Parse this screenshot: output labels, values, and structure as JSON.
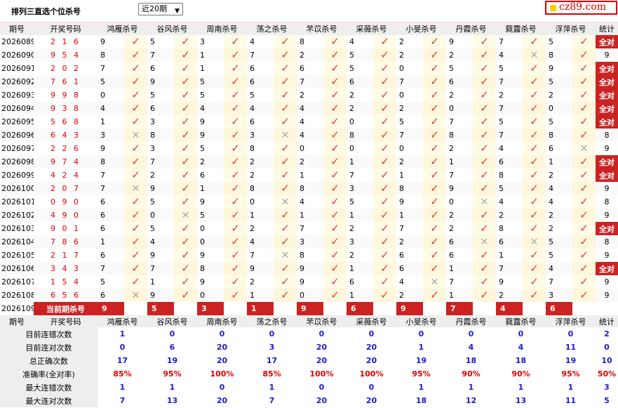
{
  "header": {
    "title": "排列三直选个位杀号",
    "period_select": "近20期",
    "site": "cz89.com"
  },
  "columns": {
    "issue": "期号",
    "draw": "开奖号码",
    "predictors": [
      "鸿雁杀号",
      "谷风杀号",
      "周南杀号",
      "荡之杀号",
      "芣苡杀号",
      "采薇杀号",
      "小旻杀号",
      "丹霞杀号",
      "蕤露杀号",
      "浮萍杀号"
    ],
    "stat": "统计"
  },
  "rows": [
    {
      "issue": "2026089",
      "draw": "2 1 6",
      "picks": [
        [
          9,
          1
        ],
        [
          5,
          1
        ],
        [
          3,
          1
        ],
        [
          4,
          1
        ],
        [
          8,
          1
        ],
        [
          4,
          1
        ],
        [
          2,
          1
        ],
        [
          9,
          1
        ],
        [
          7,
          1
        ],
        [
          5,
          1
        ]
      ],
      "stat": "全对"
    },
    {
      "issue": "2026090",
      "draw": "9 5 4",
      "picks": [
        [
          8,
          1
        ],
        [
          7,
          1
        ],
        [
          1,
          1
        ],
        [
          7,
          1
        ],
        [
          2,
          1
        ],
        [
          5,
          1
        ],
        [
          2,
          1
        ],
        [
          2,
          1
        ],
        [
          4,
          0
        ],
        [
          8,
          1
        ]
      ],
      "stat": "9"
    },
    {
      "issue": "2026091",
      "draw": "2 0 2",
      "picks": [
        [
          7,
          1
        ],
        [
          6,
          1
        ],
        [
          1,
          1
        ],
        [
          6,
          1
        ],
        [
          6,
          1
        ],
        [
          5,
          1
        ],
        [
          0,
          1
        ],
        [
          5,
          1
        ],
        [
          5,
          1
        ],
        [
          9,
          1
        ]
      ],
      "stat": "全对"
    },
    {
      "issue": "2026092",
      "draw": "7 6 1",
      "picks": [
        [
          5,
          1
        ],
        [
          9,
          1
        ],
        [
          5,
          1
        ],
        [
          6,
          1
        ],
        [
          7,
          1
        ],
        [
          6,
          1
        ],
        [
          7,
          1
        ],
        [
          6,
          1
        ],
        [
          7,
          1
        ],
        [
          5,
          1
        ]
      ],
      "stat": "全对"
    },
    {
      "issue": "2026093",
      "draw": "9 9 8",
      "picks": [
        [
          0,
          1
        ],
        [
          5,
          1
        ],
        [
          5,
          1
        ],
        [
          5,
          1
        ],
        [
          2,
          1
        ],
        [
          2,
          1
        ],
        [
          0,
          1
        ],
        [
          2,
          1
        ],
        [
          2,
          1
        ],
        [
          2,
          1
        ]
      ],
      "stat": "全对"
    },
    {
      "issue": "2026094",
      "draw": "9 3 8",
      "picks": [
        [
          4,
          1
        ],
        [
          6,
          1
        ],
        [
          4,
          1
        ],
        [
          4,
          1
        ],
        [
          4,
          1
        ],
        [
          2,
          1
        ],
        [
          2,
          1
        ],
        [
          0,
          1
        ],
        [
          7,
          1
        ],
        [
          0,
          1
        ]
      ],
      "stat": "全对"
    },
    {
      "issue": "2026095",
      "draw": "5 6 8",
      "picks": [
        [
          1,
          1
        ],
        [
          3,
          1
        ],
        [
          9,
          1
        ],
        [
          6,
          1
        ],
        [
          4,
          1
        ],
        [
          0,
          1
        ],
        [
          5,
          1
        ],
        [
          7,
          1
        ],
        [
          5,
          1
        ],
        [
          5,
          1
        ]
      ],
      "stat": "全对"
    },
    {
      "issue": "2026096",
      "draw": "6 4 3",
      "picks": [
        [
          3,
          0
        ],
        [
          8,
          1
        ],
        [
          9,
          1
        ],
        [
          3,
          0
        ],
        [
          4,
          1
        ],
        [
          8,
          1
        ],
        [
          7,
          1
        ],
        [
          8,
          1
        ],
        [
          7,
          1
        ],
        [
          8,
          1
        ]
      ],
      "stat": "8"
    },
    {
      "issue": "2026097",
      "draw": "2 2 6",
      "picks": [
        [
          9,
          1
        ],
        [
          3,
          1
        ],
        [
          5,
          1
        ],
        [
          8,
          1
        ],
        [
          0,
          1
        ],
        [
          0,
          1
        ],
        [
          0,
          1
        ],
        [
          2,
          1
        ],
        [
          4,
          1
        ],
        [
          6,
          0
        ]
      ],
      "stat": "9"
    },
    {
      "issue": "2026098",
      "draw": "9 7 4",
      "picks": [
        [
          8,
          1
        ],
        [
          7,
          1
        ],
        [
          2,
          1
        ],
        [
          2,
          1
        ],
        [
          2,
          1
        ],
        [
          1,
          1
        ],
        [
          2,
          1
        ],
        [
          1,
          1
        ],
        [
          6,
          1
        ],
        [
          1,
          1
        ]
      ],
      "stat": "全对"
    },
    {
      "issue": "2026099",
      "draw": "4 2 4",
      "picks": [
        [
          7,
          1
        ],
        [
          2,
          1
        ],
        [
          6,
          1
        ],
        [
          2,
          1
        ],
        [
          1,
          1
        ],
        [
          7,
          1
        ],
        [
          1,
          1
        ],
        [
          7,
          1
        ],
        [
          8,
          1
        ],
        [
          2,
          1
        ]
      ],
      "stat": "全对"
    },
    {
      "issue": "2026100",
      "draw": "2 0 7",
      "picks": [
        [
          7,
          0
        ],
        [
          9,
          1
        ],
        [
          1,
          1
        ],
        [
          8,
          1
        ],
        [
          8,
          1
        ],
        [
          3,
          1
        ],
        [
          8,
          1
        ],
        [
          9,
          1
        ],
        [
          5,
          1
        ],
        [
          4,
          1
        ]
      ],
      "stat": "9"
    },
    {
      "issue": "2026101",
      "draw": "0 9 0",
      "picks": [
        [
          6,
          1
        ],
        [
          5,
          1
        ],
        [
          9,
          1
        ],
        [
          0,
          0
        ],
        [
          4,
          1
        ],
        [
          5,
          1
        ],
        [
          9,
          1
        ],
        [
          0,
          0
        ],
        [
          4,
          1
        ],
        [
          4,
          1
        ]
      ],
      "stat": "8"
    },
    {
      "issue": "2026102",
      "draw": "4 9 0",
      "picks": [
        [
          6,
          1
        ],
        [
          0,
          0
        ],
        [
          5,
          1
        ],
        [
          1,
          1
        ],
        [
          1,
          1
        ],
        [
          1,
          1
        ],
        [
          1,
          1
        ],
        [
          2,
          1
        ],
        [
          2,
          1
        ],
        [
          2,
          1
        ]
      ],
      "stat": "9"
    },
    {
      "issue": "2026103",
      "draw": "9 0 1",
      "picks": [
        [
          6,
          1
        ],
        [
          5,
          1
        ],
        [
          0,
          1
        ],
        [
          2,
          1
        ],
        [
          7,
          1
        ],
        [
          2,
          1
        ],
        [
          7,
          1
        ],
        [
          2,
          1
        ],
        [
          8,
          1
        ],
        [
          2,
          1
        ]
      ],
      "stat": "全对"
    },
    {
      "issue": "2026104",
      "draw": "7 8 6",
      "picks": [
        [
          1,
          1
        ],
        [
          4,
          1
        ],
        [
          0,
          1
        ],
        [
          4,
          1
        ],
        [
          3,
          1
        ],
        [
          3,
          1
        ],
        [
          2,
          1
        ],
        [
          6,
          0
        ],
        [
          6,
          0
        ],
        [
          5,
          1
        ]
      ],
      "stat": "8"
    },
    {
      "issue": "2026105",
      "draw": "2 1 7",
      "picks": [
        [
          6,
          1
        ],
        [
          9,
          1
        ],
        [
          9,
          1
        ],
        [
          7,
          0
        ],
        [
          8,
          1
        ],
        [
          2,
          1
        ],
        [
          6,
          1
        ],
        [
          6,
          1
        ],
        [
          1,
          1
        ],
        [
          5,
          1
        ]
      ],
      "stat": "9"
    },
    {
      "issue": "2026106",
      "draw": "3 4 3",
      "picks": [
        [
          7,
          1
        ],
        [
          7,
          1
        ],
        [
          8,
          1
        ],
        [
          9,
          1
        ],
        [
          9,
          1
        ],
        [
          1,
          1
        ],
        [
          6,
          1
        ],
        [
          1,
          1
        ],
        [
          7,
          1
        ],
        [
          4,
          1
        ]
      ],
      "stat": "全对"
    },
    {
      "issue": "2026107",
      "draw": "1 5 4",
      "picks": [
        [
          5,
          1
        ],
        [
          1,
          1
        ],
        [
          9,
          1
        ],
        [
          2,
          1
        ],
        [
          9,
          1
        ],
        [
          6,
          1
        ],
        [
          4,
          0
        ],
        [
          7,
          1
        ],
        [
          9,
          1
        ],
        [
          7,
          1
        ]
      ],
      "stat": "9"
    },
    {
      "issue": "2026108",
      "draw": "6 5 6",
      "picks": [
        [
          6,
          0
        ],
        [
          9,
          1
        ],
        [
          0,
          1
        ],
        [
          1,
          1
        ],
        [
          0,
          1
        ],
        [
          1,
          1
        ],
        [
          2,
          1
        ],
        [
          1,
          1
        ],
        [
          2,
          1
        ],
        [
          3,
          1
        ]
      ],
      "stat": "9"
    }
  ],
  "current": {
    "issue": "2026109",
    "label": "当前期杀号",
    "picks": [
      "9",
      "5",
      "3",
      "1",
      "9",
      "6",
      "9",
      "7",
      "4",
      "6"
    ]
  },
  "stats": [
    {
      "label": "目前连错次数",
      "values": [
        "1",
        "0",
        "0",
        "0",
        "0",
        "0",
        "0",
        "0",
        "0",
        "0"
      ],
      "total": "2",
      "color": "blue"
    },
    {
      "label": "目前连对次数",
      "values": [
        "0",
        "6",
        "20",
        "3",
        "20",
        "20",
        "1",
        "4",
        "4",
        "11"
      ],
      "total": "0",
      "color": "blue"
    },
    {
      "label": "总正确次数",
      "values": [
        "17",
        "19",
        "20",
        "17",
        "20",
        "20",
        "19",
        "18",
        "18",
        "19"
      ],
      "total": "10",
      "color": "blue"
    },
    {
      "label": "准确率(全对率)",
      "values": [
        "85%",
        "95%",
        "100%",
        "85%",
        "100%",
        "100%",
        "95%",
        "90%",
        "90%",
        "95%"
      ],
      "total": "50%",
      "color": "red"
    },
    {
      "label": "最大连错次数",
      "values": [
        "1",
        "1",
        "0",
        "1",
        "0",
        "0",
        "1",
        "1",
        "1",
        "1"
      ],
      "total": "3",
      "color": "blue"
    },
    {
      "label": "最大连对次数",
      "values": [
        "7",
        "13",
        "20",
        "7",
        "20",
        "20",
        "18",
        "12",
        "13",
        "11"
      ],
      "total": "5",
      "color": "blue"
    }
  ],
  "icons": {
    "correct": "check-icon",
    "wrong": "cross-icon"
  },
  "colors": {
    "accent": "#cc2222",
    "check": "#e53935",
    "stat_blue": "#1a1ad0",
    "rate_red": "#e00000"
  }
}
